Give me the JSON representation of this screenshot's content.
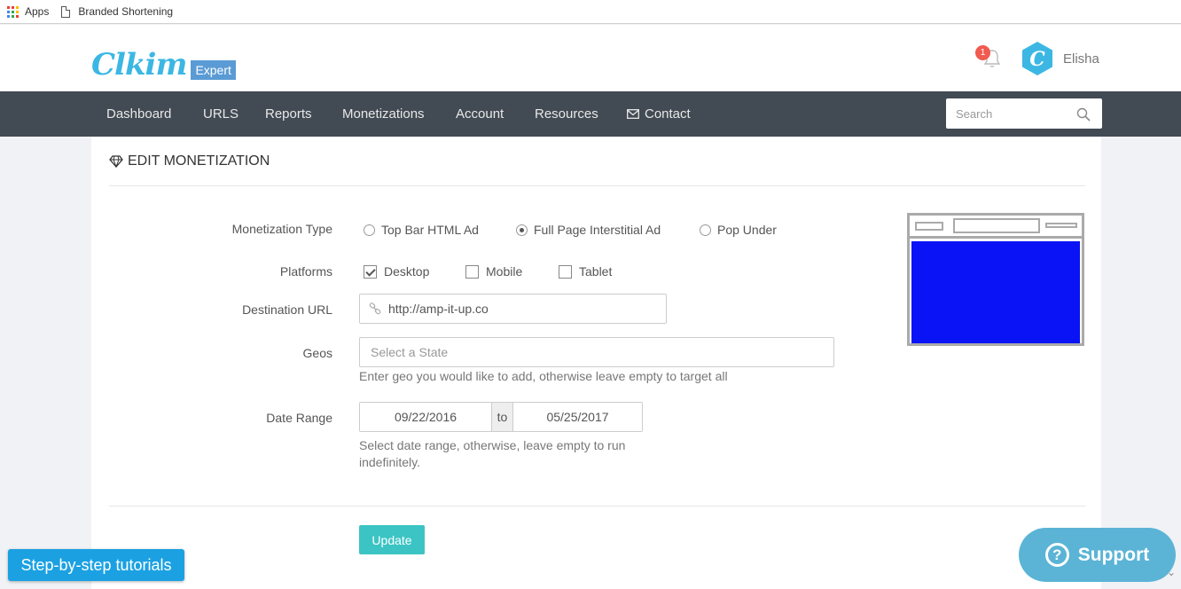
{
  "bookmarks": {
    "apps_label": "Apps",
    "branded_label": "Branded Shortening"
  },
  "header": {
    "logo_text": "Clkim",
    "logo_badge": "Expert",
    "notification_count": "1",
    "username": "Elisha",
    "avatar_letter": "C"
  },
  "nav": {
    "items": [
      "Dashboard",
      "URLS",
      "Reports",
      "Monetizations",
      "Account",
      "Resources",
      "Contact"
    ],
    "search_placeholder": "Search"
  },
  "page": {
    "title": "EDIT MONETIZATION"
  },
  "form": {
    "monetization_type": {
      "label": "Monetization Type",
      "options": [
        "Top Bar HTML Ad",
        "Full Page Interstitial Ad",
        "Pop Under"
      ],
      "selected": "Full Page Interstitial Ad"
    },
    "platforms": {
      "label": "Platforms",
      "options": [
        "Desktop",
        "Mobile",
        "Tablet"
      ],
      "checked": [
        "Desktop"
      ]
    },
    "destination_url": {
      "label": "Destination URL",
      "value": "http://amp-it-up.co"
    },
    "geos": {
      "label": "Geos",
      "placeholder": "Select a State",
      "help": "Enter geo you would like to add, otherwise leave empty to target all"
    },
    "date_range": {
      "label": "Date Range",
      "start": "09/22/2016",
      "separator": "to",
      "end": "05/25/2017",
      "help_line1": "Select date range, otherwise, leave empty to run",
      "help_line2": "indefinitely."
    },
    "update_label": "Update"
  },
  "floating": {
    "tutorials_label": "Step-by-step tutorials",
    "support_label": "Support"
  },
  "colors": {
    "brand": "#3cb7e4",
    "nav_bg": "#424a53",
    "update_btn": "#3cc4c4",
    "preview_fill": "#0a13f6"
  }
}
